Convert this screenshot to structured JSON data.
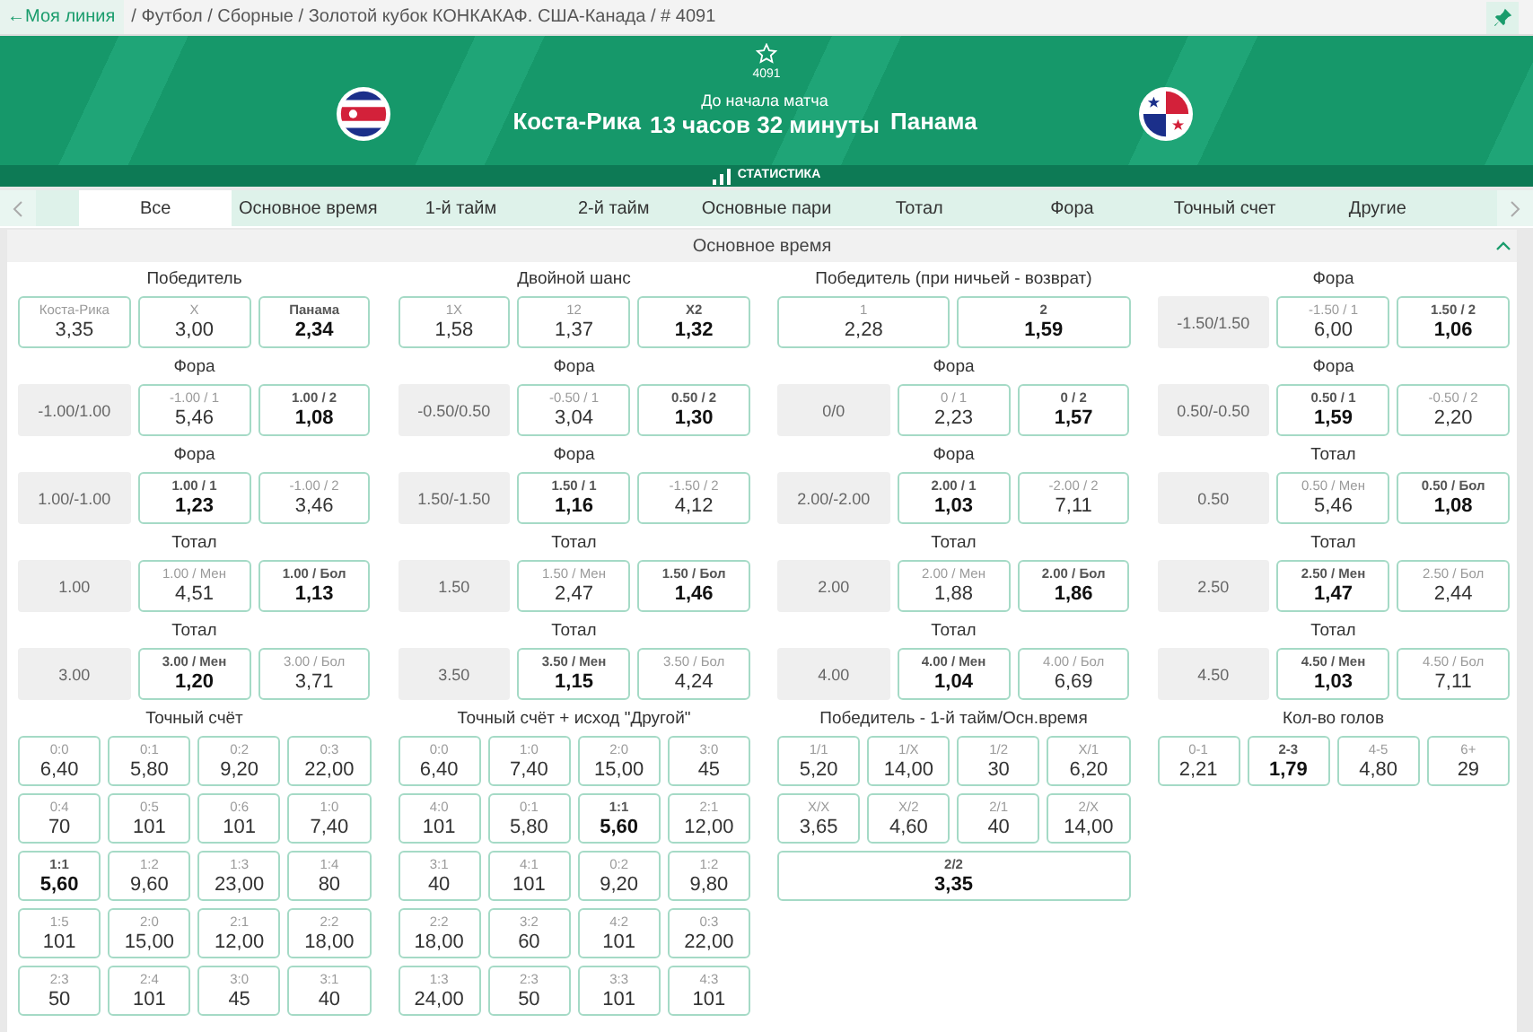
{
  "breadcrumb": {
    "back_link": "←Моя линия",
    "path": "/ Футбол / Сборные / Золотой кубок КОНКАКАФ. США-Канада / # 4091"
  },
  "event": {
    "number": "4091",
    "home_team": "Коста-Рика",
    "away_team": "Панама",
    "countdown_label": "До начала матча",
    "countdown": "13 часов 32 минуты"
  },
  "stats_bar": {
    "label": "СТАТИСТИКА"
  },
  "tabs": [
    {
      "label": "Все",
      "selected": true
    },
    {
      "label": "Основное время",
      "selected": false
    },
    {
      "label": "1-й тайм",
      "selected": false
    },
    {
      "label": "2-й тайм",
      "selected": false
    },
    {
      "label": "Основные пари",
      "selected": false
    },
    {
      "label": "Тотал",
      "selected": false
    },
    {
      "label": "Фора",
      "selected": false
    },
    {
      "label": "Точный счет",
      "selected": false
    },
    {
      "label": "Другие",
      "selected": false
    }
  ],
  "section": {
    "title": "Основное время",
    "expanded": true
  },
  "columns": [
    {
      "markets": [
        {
          "kind": "outcomes",
          "title": "Победитель",
          "outcomes": [
            {
              "label": "Коста-Рика",
              "odds": "3,35",
              "highlighted": false
            },
            {
              "label": "X",
              "odds": "3,00",
              "highlighted": false
            },
            {
              "label": "Панама",
              "odds": "2,34",
              "highlighted": true
            }
          ]
        },
        {
          "kind": "line",
          "title": "Фора",
          "line": "-1.00/1.00",
          "outcomes": [
            {
              "label": "-1.00 / 1",
              "odds": "5,46",
              "highlighted": false
            },
            {
              "label": "1.00 / 2",
              "odds": "1,08",
              "highlighted": true
            }
          ]
        },
        {
          "kind": "line",
          "title": "Фора",
          "line": "1.00/-1.00",
          "outcomes": [
            {
              "label": "1.00 / 1",
              "odds": "1,23",
              "highlighted": true
            },
            {
              "label": "-1.00 / 2",
              "odds": "3,46",
              "highlighted": false
            }
          ]
        },
        {
          "kind": "line",
          "title": "Тотал",
          "line": "1.00",
          "outcomes": [
            {
              "label": "1.00 / Мен",
              "odds": "4,51",
              "highlighted": false
            },
            {
              "label": "1.00 / Бол",
              "odds": "1,13",
              "highlighted": true
            }
          ]
        },
        {
          "kind": "line",
          "title": "Тотал",
          "line": "3.00",
          "outcomes": [
            {
              "label": "3.00 / Мен",
              "odds": "1,20",
              "highlighted": true
            },
            {
              "label": "3.00 / Бол",
              "odds": "3,71",
              "highlighted": false
            }
          ]
        },
        {
          "kind": "grid",
          "title": "Точный счёт",
          "outcomes": [
            {
              "label": "0:0",
              "odds": "6,40",
              "highlighted": false
            },
            {
              "label": "0:1",
              "odds": "5,80",
              "highlighted": false
            },
            {
              "label": "0:2",
              "odds": "9,20",
              "highlighted": false
            },
            {
              "label": "0:3",
              "odds": "22,00",
              "highlighted": false
            },
            {
              "label": "0:4",
              "odds": "70",
              "highlighted": false
            },
            {
              "label": "0:5",
              "odds": "101",
              "highlighted": false
            },
            {
              "label": "0:6",
              "odds": "101",
              "highlighted": false
            },
            {
              "label": "1:0",
              "odds": "7,40",
              "highlighted": false
            },
            {
              "label": "1:1",
              "odds": "5,60",
              "highlighted": true
            },
            {
              "label": "1:2",
              "odds": "9,60",
              "highlighted": false
            },
            {
              "label": "1:3",
              "odds": "23,00",
              "highlighted": false
            },
            {
              "label": "1:4",
              "odds": "80",
              "highlighted": false
            },
            {
              "label": "1:5",
              "odds": "101",
              "highlighted": false
            },
            {
              "label": "2:0",
              "odds": "15,00",
              "highlighted": false
            },
            {
              "label": "2:1",
              "odds": "12,00",
              "highlighted": false
            },
            {
              "label": "2:2",
              "odds": "18,00",
              "highlighted": false
            },
            {
              "label": "2:3",
              "odds": "50",
              "highlighted": false
            },
            {
              "label": "2:4",
              "odds": "101",
              "highlighted": false
            },
            {
              "label": "3:0",
              "odds": "45",
              "highlighted": false
            },
            {
              "label": "3:1",
              "odds": "40",
              "highlighted": false
            }
          ]
        }
      ]
    },
    {
      "markets": [
        {
          "kind": "outcomes",
          "title": "Двойной шанс",
          "outcomes": [
            {
              "label": "1X",
              "odds": "1,58",
              "highlighted": false
            },
            {
              "label": "12",
              "odds": "1,37",
              "highlighted": false
            },
            {
              "label": "X2",
              "odds": "1,32",
              "highlighted": true
            }
          ]
        },
        {
          "kind": "line",
          "title": "Фора",
          "line": "-0.50/0.50",
          "outcomes": [
            {
              "label": "-0.50 / 1",
              "odds": "3,04",
              "highlighted": false
            },
            {
              "label": "0.50 / 2",
              "odds": "1,30",
              "highlighted": true
            }
          ]
        },
        {
          "kind": "line",
          "title": "Фора",
          "line": "1.50/-1.50",
          "outcomes": [
            {
              "label": "1.50 / 1",
              "odds": "1,16",
              "highlighted": true
            },
            {
              "label": "-1.50 / 2",
              "odds": "4,12",
              "highlighted": false
            }
          ]
        },
        {
          "kind": "line",
          "title": "Тотал",
          "line": "1.50",
          "outcomes": [
            {
              "label": "1.50 / Мен",
              "odds": "2,47",
              "highlighted": false
            },
            {
              "label": "1.50 / Бол",
              "odds": "1,46",
              "highlighted": true
            }
          ]
        },
        {
          "kind": "line",
          "title": "Тотал",
          "line": "3.50",
          "outcomes": [
            {
              "label": "3.50 / Мен",
              "odds": "1,15",
              "highlighted": true
            },
            {
              "label": "3.50 / Бол",
              "odds": "4,24",
              "highlighted": false
            }
          ]
        },
        {
          "kind": "grid",
          "title": "Точный счёт + исход \"Другой\"",
          "outcomes": [
            {
              "label": "0:0",
              "odds": "6,40",
              "highlighted": false
            },
            {
              "label": "1:0",
              "odds": "7,40",
              "highlighted": false
            },
            {
              "label": "2:0",
              "odds": "15,00",
              "highlighted": false
            },
            {
              "label": "3:0",
              "odds": "45",
              "highlighted": false
            },
            {
              "label": "4:0",
              "odds": "101",
              "highlighted": false
            },
            {
              "label": "0:1",
              "odds": "5,80",
              "highlighted": false
            },
            {
              "label": "1:1",
              "odds": "5,60",
              "highlighted": true
            },
            {
              "label": "2:1",
              "odds": "12,00",
              "highlighted": false
            },
            {
              "label": "3:1",
              "odds": "40",
              "highlighted": false
            },
            {
              "label": "4:1",
              "odds": "101",
              "highlighted": false
            },
            {
              "label": "0:2",
              "odds": "9,20",
              "highlighted": false
            },
            {
              "label": "1:2",
              "odds": "9,80",
              "highlighted": false
            },
            {
              "label": "2:2",
              "odds": "18,00",
              "highlighted": false
            },
            {
              "label": "3:2",
              "odds": "60",
              "highlighted": false
            },
            {
              "label": "4:2",
              "odds": "101",
              "highlighted": false
            },
            {
              "label": "0:3",
              "odds": "22,00",
              "highlighted": false
            },
            {
              "label": "1:3",
              "odds": "24,00",
              "highlighted": false
            },
            {
              "label": "2:3",
              "odds": "50",
              "highlighted": false
            },
            {
              "label": "3:3",
              "odds": "101",
              "highlighted": false
            },
            {
              "label": "4:3",
              "odds": "101",
              "highlighted": false
            }
          ]
        }
      ]
    },
    {
      "markets": [
        {
          "kind": "outcomes",
          "title": "Победитель (при ничьей - возврат)",
          "outcomes": [
            {
              "label": "1",
              "odds": "2,28",
              "highlighted": false
            },
            {
              "label": "2",
              "odds": "1,59",
              "highlighted": true
            }
          ]
        },
        {
          "kind": "line",
          "title": "Фора",
          "line": "0/0",
          "outcomes": [
            {
              "label": "0 / 1",
              "odds": "2,23",
              "highlighted": false
            },
            {
              "label": "0 / 2",
              "odds": "1,57",
              "highlighted": true
            }
          ]
        },
        {
          "kind": "line",
          "title": "Фора",
          "line": "2.00/-2.00",
          "outcomes": [
            {
              "label": "2.00 / 1",
              "odds": "1,03",
              "highlighted": true
            },
            {
              "label": "-2.00 / 2",
              "odds": "7,11",
              "highlighted": false
            }
          ]
        },
        {
          "kind": "line",
          "title": "Тотал",
          "line": "2.00",
          "outcomes": [
            {
              "label": "2.00 / Мен",
              "odds": "1,88",
              "highlighted": false
            },
            {
              "label": "2.00 / Бол",
              "odds": "1,86",
              "highlighted": true
            }
          ]
        },
        {
          "kind": "line",
          "title": "Тотал",
          "line": "4.00",
          "outcomes": [
            {
              "label": "4.00 / Мен",
              "odds": "1,04",
              "highlighted": true
            },
            {
              "label": "4.00 / Бол",
              "odds": "6,69",
              "highlighted": false
            }
          ]
        },
        {
          "kind": "grid",
          "title": "Победитель - 1-й тайм/Осн.время",
          "outcomes": [
            {
              "label": "1/1",
              "odds": "5,20",
              "highlighted": false
            },
            {
              "label": "1/X",
              "odds": "14,00",
              "highlighted": false
            },
            {
              "label": "1/2",
              "odds": "30",
              "highlighted": false
            },
            {
              "label": "X/1",
              "odds": "6,20",
              "highlighted": false
            },
            {
              "label": "X/X",
              "odds": "3,65",
              "highlighted": false
            },
            {
              "label": "X/2",
              "odds": "4,60",
              "highlighted": false
            },
            {
              "label": "2/1",
              "odds": "40",
              "highlighted": false
            },
            {
              "label": "2/X",
              "odds": "14,00",
              "highlighted": false
            },
            {
              "label": "2/2",
              "odds": "3,35",
              "highlighted": true
            }
          ]
        }
      ]
    },
    {
      "markets": [
        {
          "kind": "line",
          "title": "Фора",
          "line": "-1.50/1.50",
          "outcomes": [
            {
              "label": "-1.50 / 1",
              "odds": "6,00",
              "highlighted": false
            },
            {
              "label": "1.50 / 2",
              "odds": "1,06",
              "highlighted": true
            }
          ]
        },
        {
          "kind": "line",
          "title": "Фора",
          "line": "0.50/-0.50",
          "outcomes": [
            {
              "label": "0.50 / 1",
              "odds": "1,59",
              "highlighted": true
            },
            {
              "label": "-0.50 / 2",
              "odds": "2,20",
              "highlighted": false
            }
          ]
        },
        {
          "kind": "line",
          "title": "Тотал",
          "line": "0.50",
          "outcomes": [
            {
              "label": "0.50 / Мен",
              "odds": "5,46",
              "highlighted": false
            },
            {
              "label": "0.50 / Бол",
              "odds": "1,08",
              "highlighted": true
            }
          ]
        },
        {
          "kind": "line",
          "title": "Тотал",
          "line": "2.50",
          "outcomes": [
            {
              "label": "2.50 / Мен",
              "odds": "1,47",
              "highlighted": true
            },
            {
              "label": "2.50 / Бол",
              "odds": "2,44",
              "highlighted": false
            }
          ]
        },
        {
          "kind": "line",
          "title": "Тотал",
          "line": "4.50",
          "outcomes": [
            {
              "label": "4.50 / Мен",
              "odds": "1,03",
              "highlighted": true
            },
            {
              "label": "4.50 / Бол",
              "odds": "7,11",
              "highlighted": false
            }
          ]
        },
        {
          "kind": "grid",
          "title": "Кол-во голов",
          "outcomes": [
            {
              "label": "0-1",
              "odds": "2,21",
              "highlighted": false
            },
            {
              "label": "2-3",
              "odds": "1,79",
              "highlighted": true
            },
            {
              "label": "4-5",
              "odds": "4,80",
              "highlighted": false
            },
            {
              "label": "6+",
              "odds": "29",
              "highlighted": false
            }
          ]
        }
      ]
    }
  ]
}
